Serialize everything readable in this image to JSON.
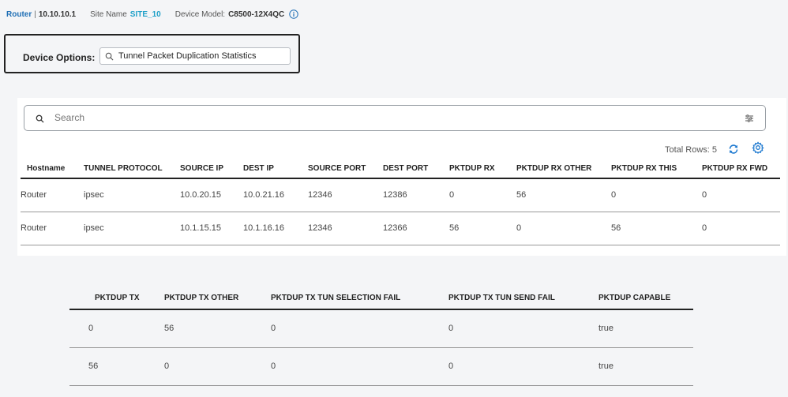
{
  "device_bar": {
    "router_link": "Router",
    "separator": "|",
    "ip": "10.10.10.1",
    "site_label": "Site Name",
    "site_name": "SITE_10",
    "model_label": "Device Model:",
    "model": "C8500-12X4QC",
    "info_icon": "info-icon"
  },
  "device_options": {
    "label": "Device Options:",
    "selected": "Tunnel Packet Duplication Statistics"
  },
  "search": {
    "placeholder": "Search",
    "filter_icon": "filter-icon"
  },
  "toolbar": {
    "total_rows": "Total Rows: 5",
    "refresh_icon": "refresh-icon",
    "settings_icon": "gear-icon"
  },
  "table1": {
    "columns": [
      "Hostname",
      "TUNNEL PROTOCOL",
      "SOURCE IP",
      "DEST IP",
      "SOURCE PORT",
      "DEST PORT",
      "PKTDUP RX",
      "PKTDUP RX OTHER",
      "PKTDUP RX THIS",
      "PKTDUP RX FWD"
    ],
    "rows": [
      [
        "Router",
        "ipsec",
        "10.0.20.15",
        "10.0.21.16",
        "12346",
        "12386",
        "0",
        "56",
        "0",
        "0"
      ],
      [
        "Router",
        "ipsec",
        "10.1.15.15",
        "10.1.16.16",
        "12346",
        "12366",
        "56",
        "0",
        "56",
        "0"
      ]
    ]
  },
  "table2": {
    "columns": [
      "PKTDUP TX",
      "PKTDUP TX OTHER",
      "PKTDUP TX TUN SELECTION FAIL",
      "PKTDUP TX TUN SEND FAIL",
      "PKTDUP CAPABLE"
    ],
    "rows": [
      [
        "0",
        "56",
        "0",
        "0",
        "true"
      ],
      [
        "56",
        "0",
        "0",
        "0",
        "true"
      ]
    ]
  }
}
